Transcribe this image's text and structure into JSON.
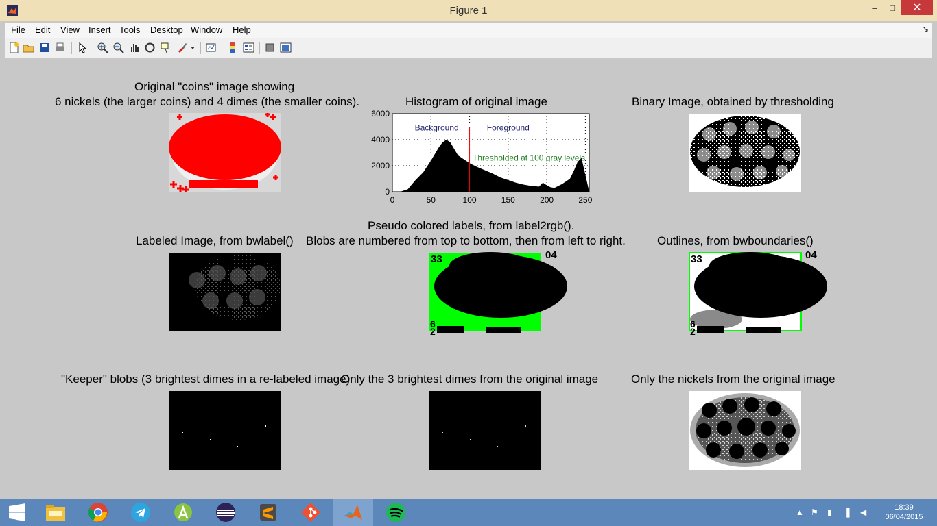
{
  "window": {
    "title": "Figure 1",
    "min": "–",
    "max": "□",
    "close": "✕"
  },
  "menu": [
    "File",
    "Edit",
    "View",
    "Insert",
    "Tools",
    "Desktop",
    "Window",
    "Help"
  ],
  "toolbar_icons": [
    "new-figure-icon",
    "open-file-icon",
    "save-icon",
    "print-icon",
    "pointer-icon",
    "zoom-in-icon",
    "zoom-out-icon",
    "pan-icon",
    "rotate-3d-icon",
    "data-cursor-icon",
    "brush-icon",
    "brush-dropdown-icon",
    "link-plot-icon",
    "colorbar-icon",
    "legend-icon",
    "hide-plot-tools-icon",
    "show-plot-tools-icon"
  ],
  "panels": {
    "p1": {
      "title_line1": "Original \"coins\" image showing",
      "title_line2": "6 nickels (the larger coins) and 4 dimes (the smaller coins)."
    },
    "p2": {
      "title": "Histogram of original image"
    },
    "p3": {
      "title": "Binary Image, obtained by thresholding"
    },
    "p4": {
      "title": "Labeled Image, from bwlabel()"
    },
    "p5": {
      "title_line1": "Pseudo colored labels, from label2rgb().",
      "title_line2": "Blobs are numbered from top to bottom, then from left to right."
    },
    "p6": {
      "title": "Outlines, from bwboundaries()"
    },
    "p7": {
      "title": "\"Keeper\" blobs (3 brightest dimes in a re-labeled image)"
    },
    "p8": {
      "title": "Only the 3 brightest dimes from the original image"
    },
    "p9": {
      "title": "Only the nickels from the original image"
    }
  },
  "labels_overlay": {
    "top_left": "33",
    "top_right": "04",
    "bottom_left_a": "6",
    "bottom_left_b": "2"
  },
  "chart_data": {
    "type": "area",
    "title": "Histogram of original image",
    "xlim": [
      0,
      255
    ],
    "ylim": [
      0,
      6000
    ],
    "xticks": [
      0,
      50,
      100,
      150,
      200,
      250
    ],
    "yticks": [
      0,
      2000,
      4000,
      6000
    ],
    "grid": true,
    "x": [
      0,
      10,
      20,
      30,
      40,
      50,
      60,
      65,
      70,
      75,
      80,
      85,
      90,
      95,
      100,
      110,
      120,
      130,
      140,
      150,
      160,
      170,
      180,
      190,
      195,
      200,
      205,
      210,
      220,
      230,
      235,
      240,
      245,
      250,
      255
    ],
    "y": [
      0,
      0,
      200,
      900,
      1500,
      2400,
      3400,
      3800,
      4000,
      3800,
      3300,
      2800,
      2600,
      2400,
      2200,
      1900,
      1650,
      1400,
      1100,
      900,
      700,
      550,
      450,
      400,
      700,
      500,
      350,
      300,
      600,
      1000,
      1600,
      2300,
      2600,
      1300,
      0
    ],
    "threshold": 100,
    "annotations": {
      "left": "Background",
      "right": "Foreground",
      "threshold_label": "Thresholded at 100 gray levels"
    },
    "annotation_colors": {
      "region": "#202070",
      "threshold": "#208020",
      "line": "#ff0000"
    }
  },
  "taskbar": {
    "apps": [
      "windows-start-icon",
      "file-explorer-icon",
      "chrome-icon",
      "telegram-icon",
      "android-studio-icon",
      "eclipse-icon",
      "sublime-text-icon",
      "git-icon",
      "matlab-icon",
      "spotify-icon"
    ],
    "time": "18:39",
    "date": "06/04/2015"
  }
}
